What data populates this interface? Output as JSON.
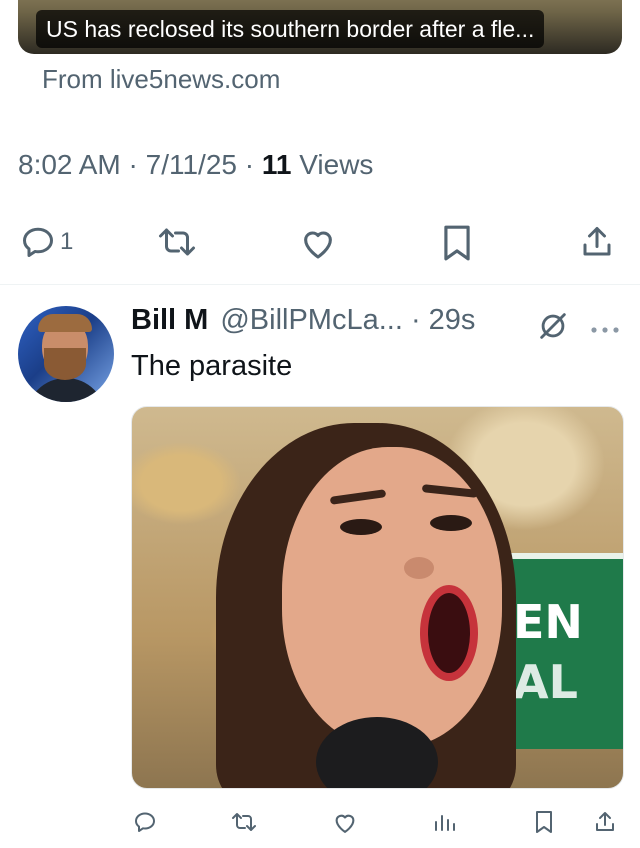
{
  "link_card": {
    "caption": "US has reclosed its southern border after a fle...",
    "source": "From live5news.com"
  },
  "main_post": {
    "time": "8:02 AM",
    "date": "7/11/25",
    "views_count": "11",
    "views_label": "Views",
    "actions": {
      "reply_count": "1",
      "icons": [
        "reply-icon",
        "retweet-icon",
        "like-icon",
        "bookmark-icon",
        "share-icon"
      ]
    }
  },
  "reply_post": {
    "author_name": "Bill M",
    "handle": "@BillPMcLa...",
    "time_ago": "29s",
    "text": "The parasite",
    "photo_sign_text": [
      "EN",
      "AL"
    ],
    "actions": {
      "icons": [
        "reply-icon",
        "retweet-icon",
        "like-icon",
        "views-icon",
        "bookmark-icon",
        "share-icon"
      ]
    }
  },
  "colors": {
    "text_primary": "#0f1419",
    "text_secondary": "#536471",
    "divider": "#eff3f4"
  }
}
